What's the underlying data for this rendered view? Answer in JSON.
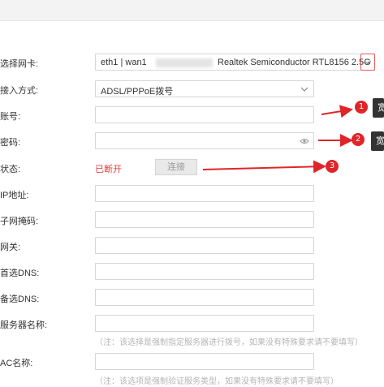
{
  "form": {
    "nic": {
      "label": "选择网卡:",
      "value_prefix": "eth1 | wan1",
      "value_suffix": "Realtek Semiconductor RTL8156 2.5G"
    },
    "access_mode": {
      "label": "接入方式:",
      "value": "ADSL/PPPoE拨号"
    },
    "account": {
      "label": "账号:",
      "value": ""
    },
    "password": {
      "label": "密码:",
      "value": ""
    },
    "status": {
      "label": "状态:",
      "value": "已断开",
      "button": "连接"
    },
    "ip": {
      "label": "IP地址:"
    },
    "mask": {
      "label": "子网掩码:"
    },
    "gateway": {
      "label": "网关:"
    },
    "dns1": {
      "label": "首选DNS:"
    },
    "dns2": {
      "label": "备选DNS:"
    },
    "server": {
      "label": "服务器名称:",
      "note": "（注：该选择是强制指定服务器进行拨号，如果没有特殊要求请不要填写）"
    },
    "ac": {
      "label": "AC名称:",
      "note": "（注：该选项是强制验证服务类型，如果没有特殊要求请不要填写）"
    }
  },
  "annotations": {
    "badge1": "1",
    "badge2": "2",
    "badge3": "3",
    "callout1": "宽",
    "callout2": "宽"
  },
  "colors": {
    "accent_red": "#e0252a",
    "status_red": "#e23b3b"
  }
}
